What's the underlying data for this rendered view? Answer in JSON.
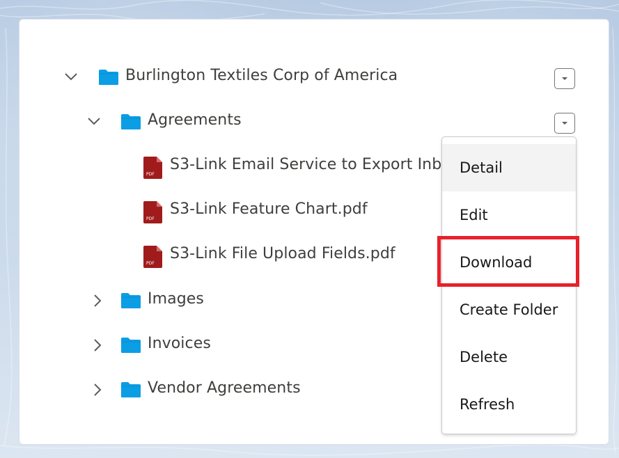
{
  "tree": {
    "root": {
      "label": "Burlington Textiles Corp of America",
      "expanded": true,
      "icon": "folder-icon"
    },
    "agreements": {
      "label": "Agreements",
      "expanded": true,
      "icon": "folder-icon",
      "files": [
        {
          "label": "S3-Link Email Service to Export Inbound Emails.pdf",
          "icon": "pdf-file-icon"
        },
        {
          "label": "S3-Link Feature Chart.pdf",
          "icon": "pdf-file-icon"
        },
        {
          "label": "S3-Link File Upload Fields.pdf",
          "icon": "pdf-file-icon"
        }
      ]
    },
    "folders": [
      {
        "label": "Images",
        "expanded": false,
        "icon": "folder-icon"
      },
      {
        "label": "Invoices",
        "expanded": false,
        "icon": "folder-icon"
      },
      {
        "label": "Vendor Agreements",
        "expanded": false,
        "icon": "folder-icon"
      }
    ]
  },
  "menu": {
    "items": [
      {
        "label": "Detail"
      },
      {
        "label": "Edit"
      },
      {
        "label": "Download"
      },
      {
        "label": "Create Folder"
      },
      {
        "label": "Delete"
      },
      {
        "label": "Refresh"
      }
    ],
    "highlighted_item": "Download"
  },
  "colors": {
    "folder": "#0b9ee5",
    "pdf": "#a01c1c",
    "highlight_border": "#e8212a",
    "text": "#3e3e3c"
  }
}
